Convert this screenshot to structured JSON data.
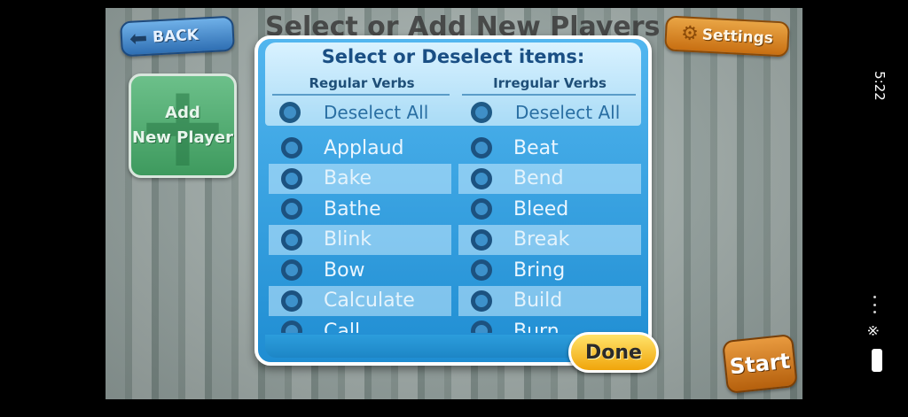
{
  "screen": {
    "title": "Select or Add New Players"
  },
  "buttons": {
    "back": "BACK",
    "settings": "Settings",
    "add_player_line1": "Add",
    "add_player_line2": "New Player",
    "start": "Start",
    "done": "Done"
  },
  "dialog": {
    "title": "Select or Deselect items:",
    "regular_header": "Regular Verbs",
    "irregular_header": "Irregular Verbs",
    "regular_deselect": "Deselect All",
    "irregular_deselect": "Deselect All",
    "regular_verbs": [
      "Applaud",
      "Bake",
      "Bathe",
      "Blink",
      "Bow",
      "Calculate",
      "Call"
    ],
    "irregular_verbs": [
      "Beat",
      "Bend",
      "Bleed",
      "Break",
      "Bring",
      "Build",
      "Burn"
    ]
  },
  "status_bar": {
    "time": "5:22"
  },
  "colors": {
    "dialog_blue": "#1f8dd2",
    "back_blue": "#2f6fb3",
    "settings_orange": "#c86f12",
    "add_green": "#3e9a5e",
    "done_yellow": "#f0a50b"
  },
  "icons": [
    "back-arrow-icon",
    "gear-icon",
    "plus-icon",
    "signal-icon",
    "battery-icon"
  ]
}
